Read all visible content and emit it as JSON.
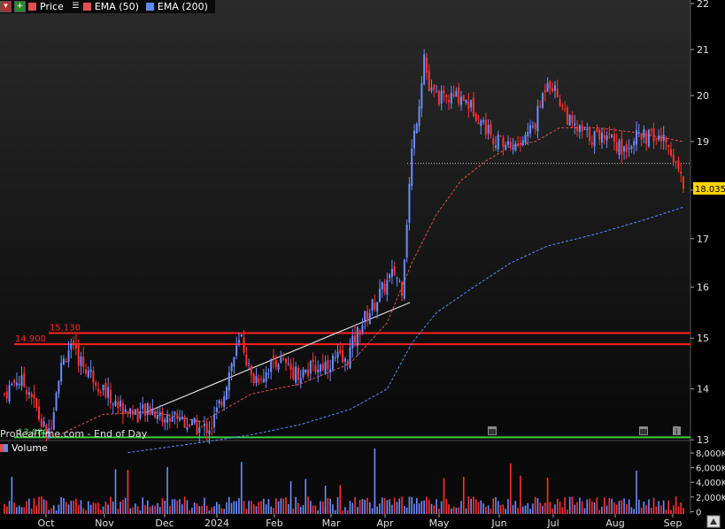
{
  "legend": {
    "price": "Price",
    "ema50": "EMA (50)",
    "ema200": "EMA (200)",
    "price_color": "#e05050",
    "ema50_color": "#e05050",
    "ema200_color": "#5a8cff"
  },
  "volume_legend": "Volume",
  "watermark": "ProRealTime.com - End of Day",
  "chart_data": {
    "type": "candlestick",
    "y_ticks": [
      "22",
      "21",
      "20",
      "19",
      "18",
      "17",
      "16",
      "15",
      "14",
      "13"
    ],
    "ylim": [
      12.4,
      22.1
    ],
    "last_price": "18.035",
    "months": [
      "Oct",
      "Nov",
      "Dec",
      "2024",
      "Feb",
      "Mar",
      "Apr",
      "May",
      "Jun",
      "Jul",
      "Aug",
      "Sep"
    ],
    "volume_ticks": [
      "8,000K",
      "6,000K",
      "4,000K",
      "2,000K",
      "0"
    ],
    "horizontal_levels": [
      {
        "label": "15.130",
        "value": 15.1,
        "color": "#ff2020"
      },
      {
        "label": "14.900",
        "value": 14.88,
        "color": "#ff2020"
      },
      {
        "label": "13.080",
        "value": 13.05,
        "color": "#40d040"
      }
    ],
    "resistance_dotted": 18.55,
    "trendline": {
      "from": [
        0.0,
        13.25
      ],
      "to": [
        1.0,
        14.85
      ]
    },
    "price_path": [
      [
        0,
        13.9
      ],
      [
        5,
        14.2
      ],
      [
        10,
        14.0
      ],
      [
        15,
        13.3
      ],
      [
        18,
        13.1
      ],
      [
        22,
        14.3
      ],
      [
        26,
        14.8
      ],
      [
        30,
        14.6
      ],
      [
        35,
        14.3
      ],
      [
        40,
        14.0
      ],
      [
        45,
        13.7
      ],
      [
        50,
        13.6
      ],
      [
        55,
        13.5
      ],
      [
        60,
        13.6
      ],
      [
        65,
        13.4
      ],
      [
        70,
        13.5
      ],
      [
        75,
        13.3
      ],
      [
        80,
        13.2
      ],
      [
        84,
        13.3
      ],
      [
        88,
        13.8
      ],
      [
        92,
        14.5
      ],
      [
        96,
        15.0
      ],
      [
        100,
        14.2
      ],
      [
        105,
        14.3
      ],
      [
        110,
        14.6
      ],
      [
        115,
        14.4
      ],
      [
        120,
        14.3
      ],
      [
        125,
        14.4
      ],
      [
        130,
        14.5
      ],
      [
        135,
        14.6
      ],
      [
        138,
        14.5
      ],
      [
        142,
        15.0
      ],
      [
        145,
        15.3
      ],
      [
        150,
        15.7
      ],
      [
        155,
        16.1
      ],
      [
        158,
        16.3
      ],
      [
        161,
        16.0
      ],
      [
        165,
        18.8
      ],
      [
        168,
        19.9
      ],
      [
        170,
        20.9
      ],
      [
        172,
        20.1
      ],
      [
        178,
        19.9
      ],
      [
        185,
        20.0
      ],
      [
        190,
        19.7
      ],
      [
        195,
        19.3
      ],
      [
        200,
        19.0
      ],
      [
        208,
        18.9
      ],
      [
        215,
        19.4
      ],
      [
        220,
        20.4
      ],
      [
        225,
        19.9
      ],
      [
        230,
        19.3
      ],
      [
        238,
        19.1
      ],
      [
        245,
        19.2
      ],
      [
        250,
        18.8
      ],
      [
        255,
        19.1
      ],
      [
        262,
        19.1
      ],
      [
        268,
        19.0
      ],
      [
        272,
        18.6
      ],
      [
        275,
        18.1
      ]
    ],
    "ema50": [
      [
        20,
        13.05
      ],
      [
        40,
        13.5
      ],
      [
        60,
        13.55
      ],
      [
        80,
        13.35
      ],
      [
        100,
        13.9
      ],
      [
        120,
        14.1
      ],
      [
        140,
        14.5
      ],
      [
        155,
        15.3
      ],
      [
        165,
        16.5
      ],
      [
        175,
        17.5
      ],
      [
        185,
        18.2
      ],
      [
        195,
        18.6
      ],
      [
        205,
        18.9
      ],
      [
        215,
        19.0
      ],
      [
        225,
        19.3
      ],
      [
        240,
        19.3
      ],
      [
        255,
        19.2
      ],
      [
        275,
        19.0
      ]
    ],
    "ema200": [
      [
        50,
        12.75
      ],
      [
        80,
        12.95
      ],
      [
        100,
        13.1
      ],
      [
        120,
        13.3
      ],
      [
        140,
        13.6
      ],
      [
        155,
        14.0
      ],
      [
        165,
        14.9
      ],
      [
        175,
        15.5
      ],
      [
        190,
        16.0
      ],
      [
        205,
        16.5
      ],
      [
        220,
        16.85
      ],
      [
        240,
        17.1
      ],
      [
        260,
        17.4
      ],
      [
        275,
        17.65
      ]
    ]
  }
}
